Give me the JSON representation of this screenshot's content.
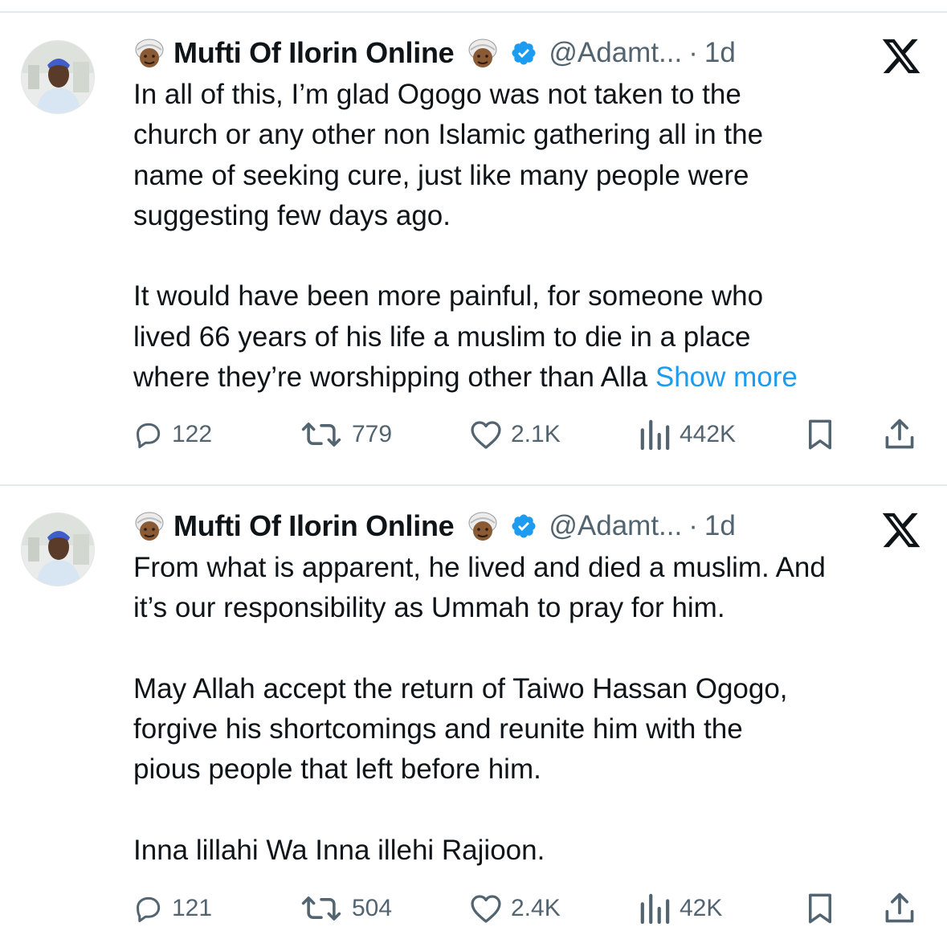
{
  "tweets": [
    {
      "display_name": "Mufti Of Ilorin Online",
      "handle": "@Adamt...",
      "separator": "·",
      "time": "1d",
      "lines": [
        "In all of this, I’m glad Ogogo  was not taken to the",
        "church or any other non Islamic gathering all in the",
        "name of seeking cure, just like many people were",
        "suggesting few days ago.",
        "",
        "It would have been more painful, for someone who",
        "lived 66 years of his life a muslim to die in a place",
        "where they’re worshipping other than Alla"
      ],
      "show_more": "Show more",
      "replies": "122",
      "reposts": "779",
      "likes": "2.1K",
      "views": "442K"
    },
    {
      "display_name": "Mufti Of Ilorin Online",
      "handle": "@Adamt...",
      "separator": "·",
      "time": "1d",
      "lines": [
        "From what is apparent, he lived and died a muslim. And",
        "it’s our responsibility as Ummah to pray for him.",
        "",
        "May Allah accept the return of Taiwo Hassan Ogogo,",
        "forgive his shortcomings and reunite him with the",
        "pious people that left before him.",
        "",
        "Inna lillahi Wa Inna illehi Rajioon."
      ],
      "replies": "121",
      "reposts": "504",
      "likes": "2.4K",
      "views": "42K"
    }
  ],
  "colors": {
    "text": "#0f1419",
    "muted": "#536471",
    "link": "#1d9bf0",
    "verified": "#1d9bf0",
    "divider": "#e6e9ec"
  },
  "icons": [
    "turban-emoji-icon",
    "verified-badge-icon",
    "x-logo-icon",
    "reply-icon",
    "repost-icon",
    "like-icon",
    "views-icon",
    "bookmark-icon",
    "share-icon"
  ]
}
